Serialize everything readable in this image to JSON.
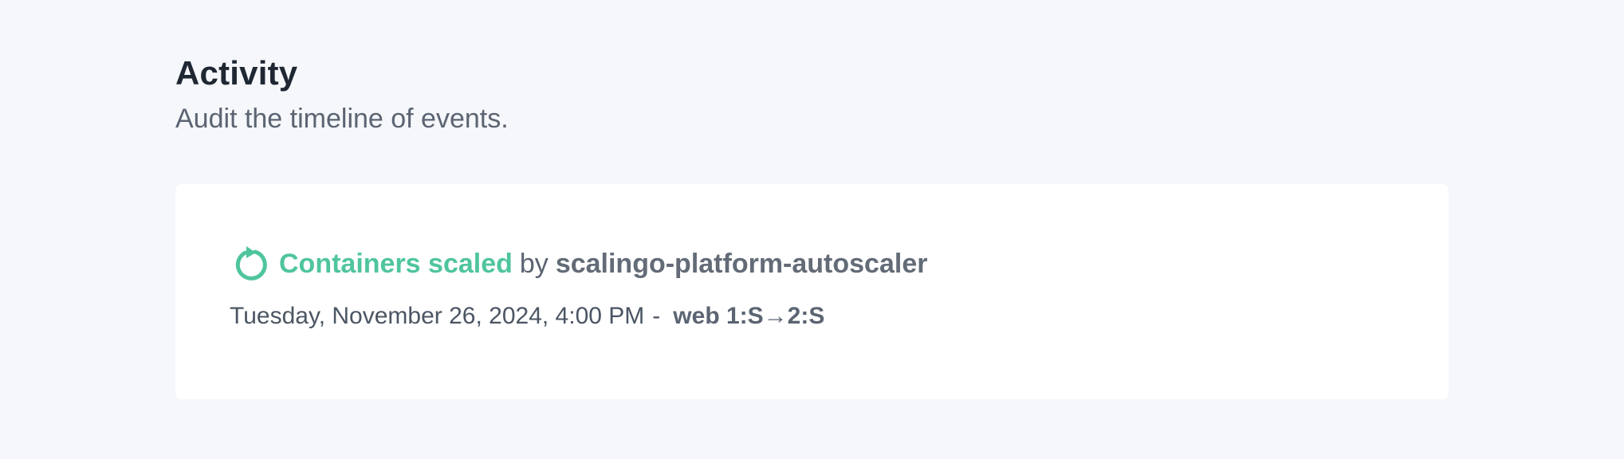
{
  "header": {
    "title": "Activity",
    "subtitle": "Audit the timeline of events."
  },
  "event": {
    "icon": "rotate-left-icon",
    "type_label": "Containers scaled",
    "by_label": "by",
    "actor": "scalingo-platform-autoscaler",
    "date": "Tuesday, November 26, 2024, 4:00 PM",
    "separator": "-",
    "change": "web 1:S→2:S"
  },
  "colors": {
    "accent": "#4fc59c",
    "background": "#f5f7fa",
    "card": "#ffffff",
    "title": "#1f2733",
    "muted": "#5b6472"
  }
}
